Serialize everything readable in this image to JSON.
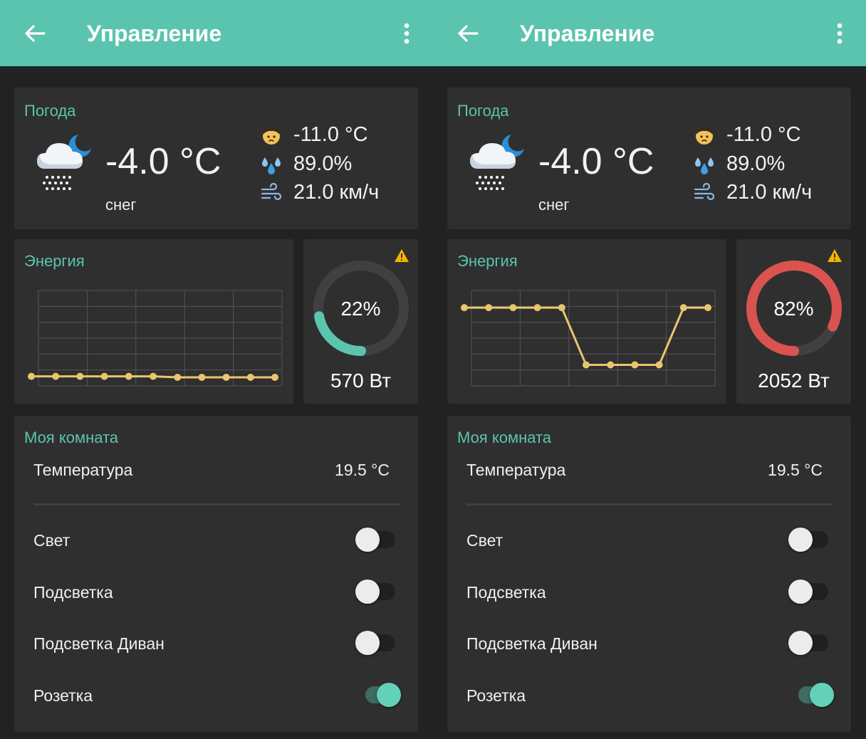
{
  "colors": {
    "accent": "#5bc4ae",
    "background": "#222222",
    "card": "#2f2f2f",
    "gauge_normal": "#5bc4ae",
    "gauge_high": "#d9534f",
    "chart_line": "#e8c66e",
    "warning": "#f5b400"
  },
  "screens": [
    {
      "appbar": {
        "title": "Управление",
        "back_icon": "arrow-left-icon",
        "menu_icon": "more-vert-icon"
      },
      "weather": {
        "title": "Погода",
        "icon": "snow-night-icon",
        "temperature": "-4.0 °C",
        "condition": "снег",
        "feels_like": "-11.0 °C",
        "humidity": "89.0%",
        "wind": "21.0 км/ч"
      },
      "energy": {
        "title": "Энергия"
      },
      "gauge": {
        "percent": "22%",
        "power": "570 Вт",
        "value": 0.22,
        "color": "#5bc4ae"
      },
      "room": {
        "title": "Моя комната",
        "temperature_label": "Температура",
        "temperature_value": "19.5 °C",
        "switches": [
          {
            "label": "Свет",
            "on": false
          },
          {
            "label": "Подсветка",
            "on": false
          },
          {
            "label": "Подсветка Диван",
            "on": false
          },
          {
            "label": "Розетка",
            "on": true
          }
        ]
      }
    },
    {
      "appbar": {
        "title": "Управление",
        "back_icon": "arrow-left-icon",
        "menu_icon": "more-vert-icon"
      },
      "weather": {
        "title": "Погода",
        "icon": "snow-night-icon",
        "temperature": "-4.0 °C",
        "condition": "снег",
        "feels_like": "-11.0 °C",
        "humidity": "89.0%",
        "wind": "21.0 км/ч"
      },
      "energy": {
        "title": "Энергия"
      },
      "gauge": {
        "percent": "82%",
        "power": "2052 Вт",
        "value": 0.82,
        "color": "#d9534f"
      },
      "room": {
        "title": "Моя комната",
        "temperature_label": "Температура",
        "temperature_value": "19.5 °C",
        "switches": [
          {
            "label": "Свет",
            "on": false
          },
          {
            "label": "Подсветка",
            "on": false
          },
          {
            "label": "Подсветка Диван",
            "on": false
          },
          {
            "label": "Розетка",
            "on": true
          }
        ]
      }
    }
  ],
  "chart_data": [
    {
      "type": "line",
      "series": [
        {
          "values": [
            0.1,
            0.1,
            0.1,
            0.1,
            0.1,
            0.1,
            0.09,
            0.09,
            0.09,
            0.09,
            0.09
          ]
        }
      ],
      "ylim": [
        0,
        1
      ],
      "grid": true
    },
    {
      "type": "line",
      "series": [
        {
          "values": [
            0.82,
            0.82,
            0.82,
            0.82,
            0.82,
            0.22,
            0.22,
            0.22,
            0.22,
            0.82,
            0.82
          ]
        }
      ],
      "ylim": [
        0,
        1
      ],
      "grid": true
    }
  ]
}
